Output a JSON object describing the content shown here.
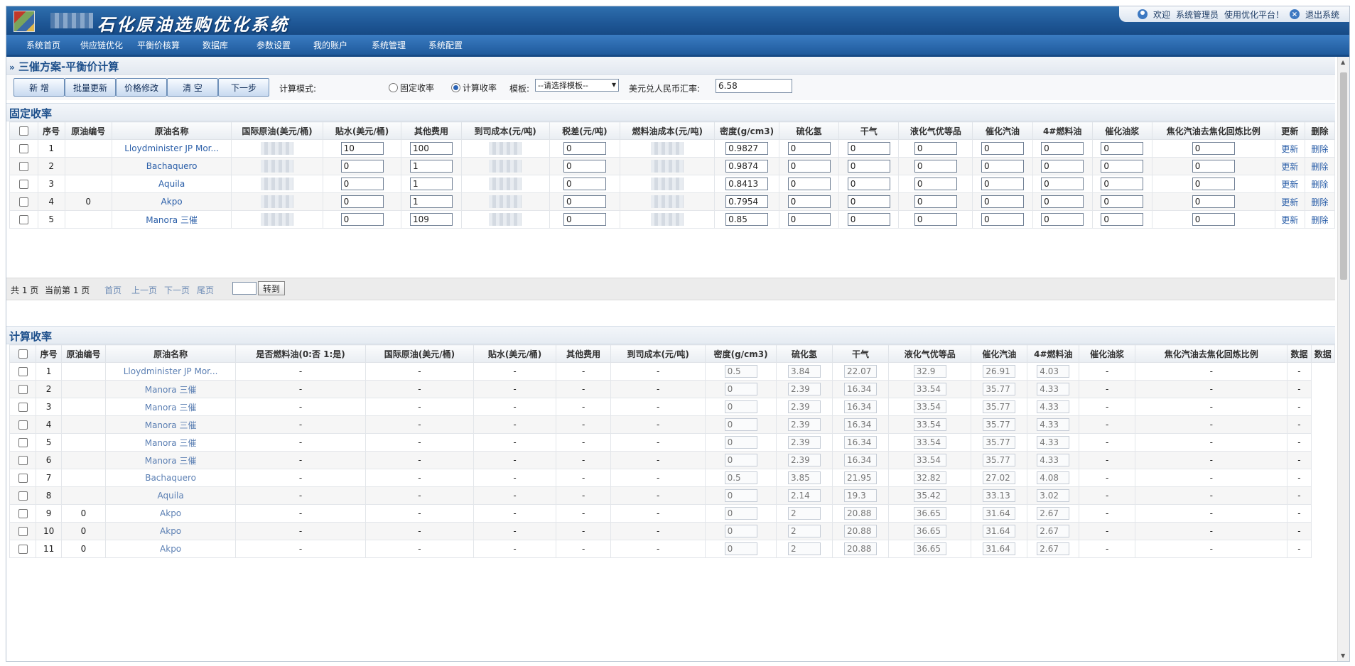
{
  "header": {
    "app_title": "石化原油选购优化系统",
    "welcome": "欢迎",
    "user": "系统管理员",
    "greeting": "使用优化平台！",
    "logout": "退出系统"
  },
  "nav": [
    "系统首页",
    "供应链优化",
    "平衡价核算",
    "数据库",
    "参数设置",
    "我的账户",
    "系统管理",
    "系统配置"
  ],
  "page": {
    "title": "三催方案-平衡价计算",
    "buttons": {
      "add": "新 增",
      "batch_update": "批量更新",
      "price_edit": "价格修改",
      "clear": "清 空",
      "next": "下一步"
    },
    "calc_mode_label": "计算模式:",
    "mode_fixed": "固定收率",
    "mode_calc": "计算收率",
    "mode_selected": "计算收率",
    "template_label": "模板:",
    "template_value": "--请选择模板--",
    "rate_label": "美元兑人民币汇率:",
    "rate_value": "6.58"
  },
  "fixed": {
    "title": "固定收率",
    "headers": [
      "序号",
      "原油编号",
      "原油名称",
      "国际原油(美元/桶)",
      "贴水(美元/桶)",
      "其他费用",
      "到司成本(元/吨)",
      "税差(元/吨)",
      "燃料油成本(元/吨)",
      "密度(g/cm3)",
      "硫化氢",
      "干气",
      "液化气优等品",
      "催化汽油",
      "4#燃料油",
      "催化油浆",
      "焦化汽油去焦化回炼比例",
      "更新",
      "删除"
    ],
    "rows": [
      {
        "no": "1",
        "code": "",
        "name": "Lloydminister JP Mor...",
        "premium": "10",
        "other": "100",
        "tax": "0",
        "density": "0.9827",
        "h2s": "0",
        "dry_gas": "0",
        "lpg": "0",
        "gasoline": "0",
        "fuel4": "0",
        "slurry": "0",
        "coking": "0",
        "update": "更新",
        "delete": "删除"
      },
      {
        "no": "2",
        "code": "",
        "name": "Bachaquero",
        "premium": "0",
        "other": "1",
        "tax": "0",
        "density": "0.9874",
        "h2s": "0",
        "dry_gas": "0",
        "lpg": "0",
        "gasoline": "0",
        "fuel4": "0",
        "slurry": "0",
        "coking": "0",
        "update": "更新",
        "delete": "删除"
      },
      {
        "no": "3",
        "code": "",
        "name": "Aquila",
        "premium": "0",
        "other": "1",
        "tax": "0",
        "density": "0.8413",
        "h2s": "0",
        "dry_gas": "0",
        "lpg": "0",
        "gasoline": "0",
        "fuel4": "0",
        "slurry": "0",
        "coking": "0",
        "update": "更新",
        "delete": "删除"
      },
      {
        "no": "4",
        "code": "0",
        "name": "Akpo",
        "premium": "0",
        "other": "1",
        "tax": "0",
        "density": "0.7954",
        "h2s": "0",
        "dry_gas": "0",
        "lpg": "0",
        "gasoline": "0",
        "fuel4": "0",
        "slurry": "0",
        "coking": "0",
        "update": "更新",
        "delete": "删除"
      },
      {
        "no": "5",
        "code": "",
        "name": "Manora 三催",
        "premium": "0",
        "other": "109",
        "tax": "0",
        "density": "0.85",
        "h2s": "0",
        "dry_gas": "0",
        "lpg": "0",
        "gasoline": "0",
        "fuel4": "0",
        "slurry": "0",
        "coking": "0",
        "update": "更新",
        "delete": "删除"
      }
    ]
  },
  "pager": {
    "total": "共 1 页",
    "current": "当前第 1 页",
    "first": "首页",
    "prev": "上一页",
    "next": "下一页",
    "last": "尾页",
    "go": "转到"
  },
  "calc": {
    "title": "计算收率",
    "headers": [
      "序号",
      "原油编号",
      "原油名称",
      "是否燃料油(0:否 1:是)",
      "国际原油(美元/桶)",
      "贴水(美元/桶)",
      "其他费用",
      "到司成本(元/吨)",
      "密度(g/cm3)",
      "硫化氢",
      "干气",
      "液化气优等品",
      "催化汽油",
      "4#燃料油",
      "催化油浆",
      "焦化汽油去焦化回炼比例",
      "数据",
      "数据"
    ],
    "rows": [
      {
        "no": "1",
        "code": "",
        "name": "Lloydminister JP Mor...",
        "dash": "-",
        "h2s": "0.5",
        "dry_gas": "3.84",
        "lpg": "22.07",
        "gasoline": "32.9",
        "fuel4": "26.91",
        "slurry": "4.03"
      },
      {
        "no": "2",
        "code": "",
        "name": "Manora 三催",
        "dash": "-",
        "h2s": "0",
        "dry_gas": "2.39",
        "lpg": "16.34",
        "gasoline": "33.54",
        "fuel4": "35.77",
        "slurry": "4.33"
      },
      {
        "no": "3",
        "code": "",
        "name": "Manora 三催",
        "dash": "-",
        "h2s": "0",
        "dry_gas": "2.39",
        "lpg": "16.34",
        "gasoline": "33.54",
        "fuel4": "35.77",
        "slurry": "4.33"
      },
      {
        "no": "4",
        "code": "",
        "name": "Manora 三催",
        "dash": "-",
        "h2s": "0",
        "dry_gas": "2.39",
        "lpg": "16.34",
        "gasoline": "33.54",
        "fuel4": "35.77",
        "slurry": "4.33"
      },
      {
        "no": "5",
        "code": "",
        "name": "Manora 三催",
        "dash": "-",
        "h2s": "0",
        "dry_gas": "2.39",
        "lpg": "16.34",
        "gasoline": "33.54",
        "fuel4": "35.77",
        "slurry": "4.33"
      },
      {
        "no": "6",
        "code": "",
        "name": "Manora 三催",
        "dash": "-",
        "h2s": "0",
        "dry_gas": "2.39",
        "lpg": "16.34",
        "gasoline": "33.54",
        "fuel4": "35.77",
        "slurry": "4.33"
      },
      {
        "no": "7",
        "code": "",
        "name": "Bachaquero",
        "dash": "-",
        "h2s": "0.5",
        "dry_gas": "3.85",
        "lpg": "21.95",
        "gasoline": "32.82",
        "fuel4": "27.02",
        "slurry": "4.08"
      },
      {
        "no": "8",
        "code": "",
        "name": "Aquila",
        "dash": "-",
        "h2s": "0",
        "dry_gas": "2.14",
        "lpg": "19.3",
        "gasoline": "35.42",
        "fuel4": "33.13",
        "slurry": "3.02"
      },
      {
        "no": "9",
        "code": "0",
        "name": "Akpo",
        "dash": "-",
        "h2s": "0",
        "dry_gas": "2",
        "lpg": "20.88",
        "gasoline": "36.65",
        "fuel4": "31.64",
        "slurry": "2.67"
      },
      {
        "no": "10",
        "code": "0",
        "name": "Akpo",
        "dash": "-",
        "h2s": "0",
        "dry_gas": "2",
        "lpg": "20.88",
        "gasoline": "36.65",
        "fuel4": "31.64",
        "slurry": "2.67"
      },
      {
        "no": "11",
        "code": "0",
        "name": "Akpo",
        "dash": "-",
        "h2s": "0",
        "dry_gas": "2",
        "lpg": "20.88",
        "gasoline": "36.65",
        "fuel4": "31.64",
        "slurry": "2.67"
      }
    ]
  }
}
